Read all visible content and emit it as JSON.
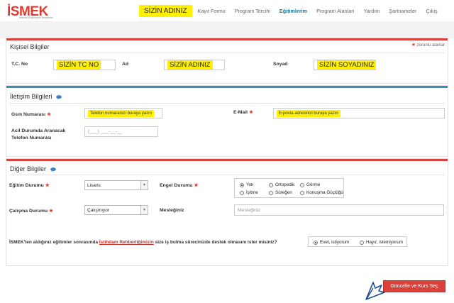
{
  "header": {
    "logo_text": "İSMEK",
    "logo_subtext": "İstanbul Büyükşehir Belediyesi",
    "user_name_highlight": "SİZİN ADINIZ",
    "nav": [
      "Kayıt Formu",
      "Program Tercihi",
      "Eğitimlerim",
      "Program Alanları",
      "Yardım",
      "Şartnameler",
      "Çıkış"
    ],
    "active_nav": "Eğitimlerim"
  },
  "personal": {
    "title": "Kişisel Bilgiler",
    "required_note": "zorunlu alanlar",
    "tc_label": "T.C. No",
    "tc_value": "SİZİN TC NO",
    "name_label": "Ad",
    "name_value": "SİZİN ADINIZ",
    "surname_label": "Soyad",
    "surname_value": "SİZİN SOYADINIZ"
  },
  "contact": {
    "title": "İletişim Bilgileri",
    "gsm_label": "Gsm Numarası",
    "gsm_value": "Telefon numaranızı buraya yazın",
    "email_label": "E-Mail",
    "email_value": "E-posta adresinizi buraya yazın",
    "emergency_label_1": "Acil Durumda Aranacak",
    "emergency_label_2": "Telefon Numarası",
    "emergency_placeholder": "(___) ___-__-__"
  },
  "other": {
    "title": "Diğer Bilgiler",
    "education_label": "Eğitim Durumu",
    "education_value": "Lisans",
    "disability_label": "Engel Durumu",
    "disability_options": [
      "Yok",
      "Ortopedik",
      "Görme",
      "İşitme",
      "Süreğen",
      "Konuşma Güçlüğü"
    ],
    "disability_selected": "Yok",
    "work_label": "Çalışma Durumu",
    "work_value": "Çalışmıyor",
    "profession_label": "Mesleğiniz",
    "profession_placeholder": "Mesleğiniz",
    "question_prefix": "İSMEK'ten aldığınız eğitimler sonrasında ",
    "question_link": "İstihdam Rehberliğimizin",
    "question_suffix": " size iş bulma sürecinizde destek olmasını ister misiniz?",
    "answer_yes": "Evet, istiyorum",
    "answer_no": "Hayır, istemiyorum",
    "answer_selected": "Evet, istiyorum"
  },
  "footer": {
    "submit_label": "Güncelle ve Kurs Seç"
  },
  "colors": {
    "accent_blue": "#3a8fb7",
    "accent_red": "#d9413a",
    "highlight_yellow": "#ffef00"
  }
}
